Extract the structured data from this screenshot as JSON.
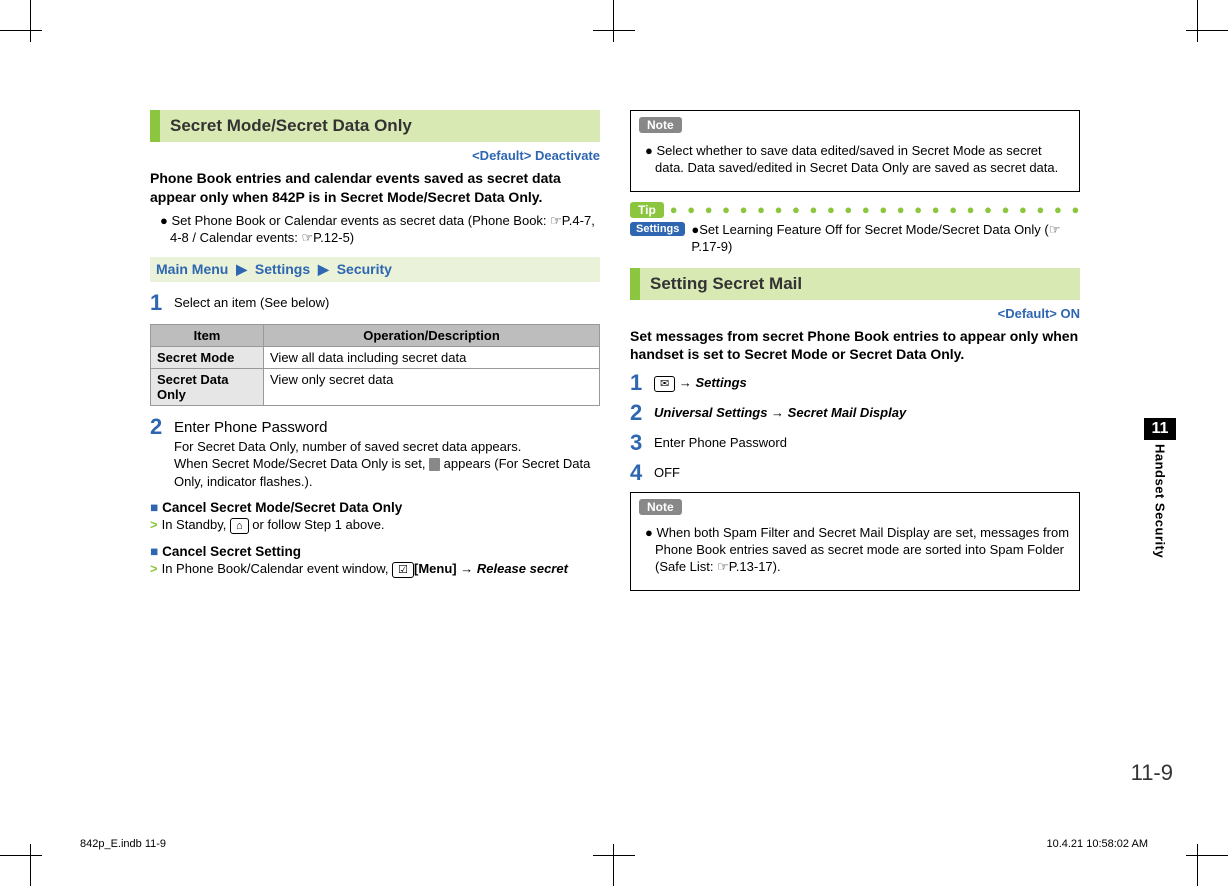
{
  "left": {
    "heading": "Secret Mode/Secret Data Only",
    "default": "<Default> Deactivate",
    "lead": "Phone Book entries and calendar events saved as secret data appear only when 842P is in Secret Mode/Secret Data Only.",
    "bullet1": "Set Phone Book or Calendar events as secret data (Phone Book: ☞P.4-7, 4-8 / Calendar events: ☞P.12-5)",
    "menu": {
      "a": "Main Menu",
      "b": "Settings",
      "c": "Security"
    },
    "step1": "Select an item (See below)",
    "table": {
      "h1": "Item",
      "h2": "Operation/Description",
      "r1c1": "Secret Mode",
      "r1c2": "View all data including secret data",
      "r2c1": "Secret Data Only",
      "r2c2": "View only secret data"
    },
    "step2a": "Enter Phone Password",
    "step2b": "For Secret Data Only, number of saved secret data appears.",
    "step2c_pre": "When Secret Mode/Secret Data Only is set, ",
    "step2c_post": " appears (For Secret Data Only, indicator flashes.).",
    "cancel_a_h": "Cancel Secret Mode/Secret Data Only",
    "cancel_a_pre": "In Standby, ",
    "cancel_a_key": "⌂",
    "cancel_a_post": " or follow Step 1 above.",
    "cancel_b_h": "Cancel Secret Setting",
    "cancel_b_pre": "In Phone Book/Calendar event window, ",
    "cancel_b_key": "☑",
    "cancel_b_menu": "[Menu]",
    "cancel_b_arrow": " → ",
    "cancel_b_rel": "Release secret"
  },
  "right": {
    "note1_label": "Note",
    "note1": "Select whether to save data edited/saved in Secret Mode as secret data. Data saved/edited in Secret Data Only are saved as secret data.",
    "tip_label": "Tip",
    "settings_badge": "Settings",
    "settings_text": "●Set Learning Feature Off for Secret Mode/Secret Data Only (☞P.17-9)",
    "heading": "Setting Secret Mail",
    "default": "<Default> ON",
    "lead": "Set messages from secret Phone Book entries to appear only when handset is set to Secret Mode or Secret Data Only.",
    "step1_key": "✉",
    "step1_arrow": " → ",
    "step1_text": "Settings",
    "step2_a": "Universal Settings",
    "step2_arrow": " → ",
    "step2_b": "Secret Mail Display",
    "step3": "Enter Phone Password",
    "step4": "OFF",
    "note2_label": "Note",
    "note2": "When both Spam Filter and Secret Mail Display are set, messages from Phone Book entries saved as secret mode are sorted into Spam Folder (Safe List: ☞P.13-17)."
  },
  "side": {
    "num": "11",
    "label": "Handset Security"
  },
  "pagenum": "11-9",
  "footer_left": "842p_E.indb   11-9",
  "footer_right": "10.4.21   10:58:02 AM"
}
